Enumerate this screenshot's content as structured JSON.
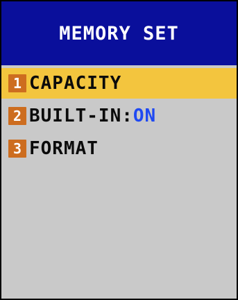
{
  "title": "MEMORY SET",
  "colors": {
    "title_bg": "#0a0f9b",
    "screen_bg": "#c9c9c9",
    "selected_bg": "#f3c53e",
    "badge_bg": "#cd6d1f",
    "value_blue": "#1f49f2"
  },
  "menu": {
    "items": [
      {
        "number": "1",
        "label": "CAPACITY",
        "value": "",
        "selected": true
      },
      {
        "number": "2",
        "label": "BUILT-IN:",
        "value": "ON",
        "selected": false
      },
      {
        "number": "3",
        "label": "FORMAT",
        "value": "",
        "selected": false
      }
    ]
  }
}
